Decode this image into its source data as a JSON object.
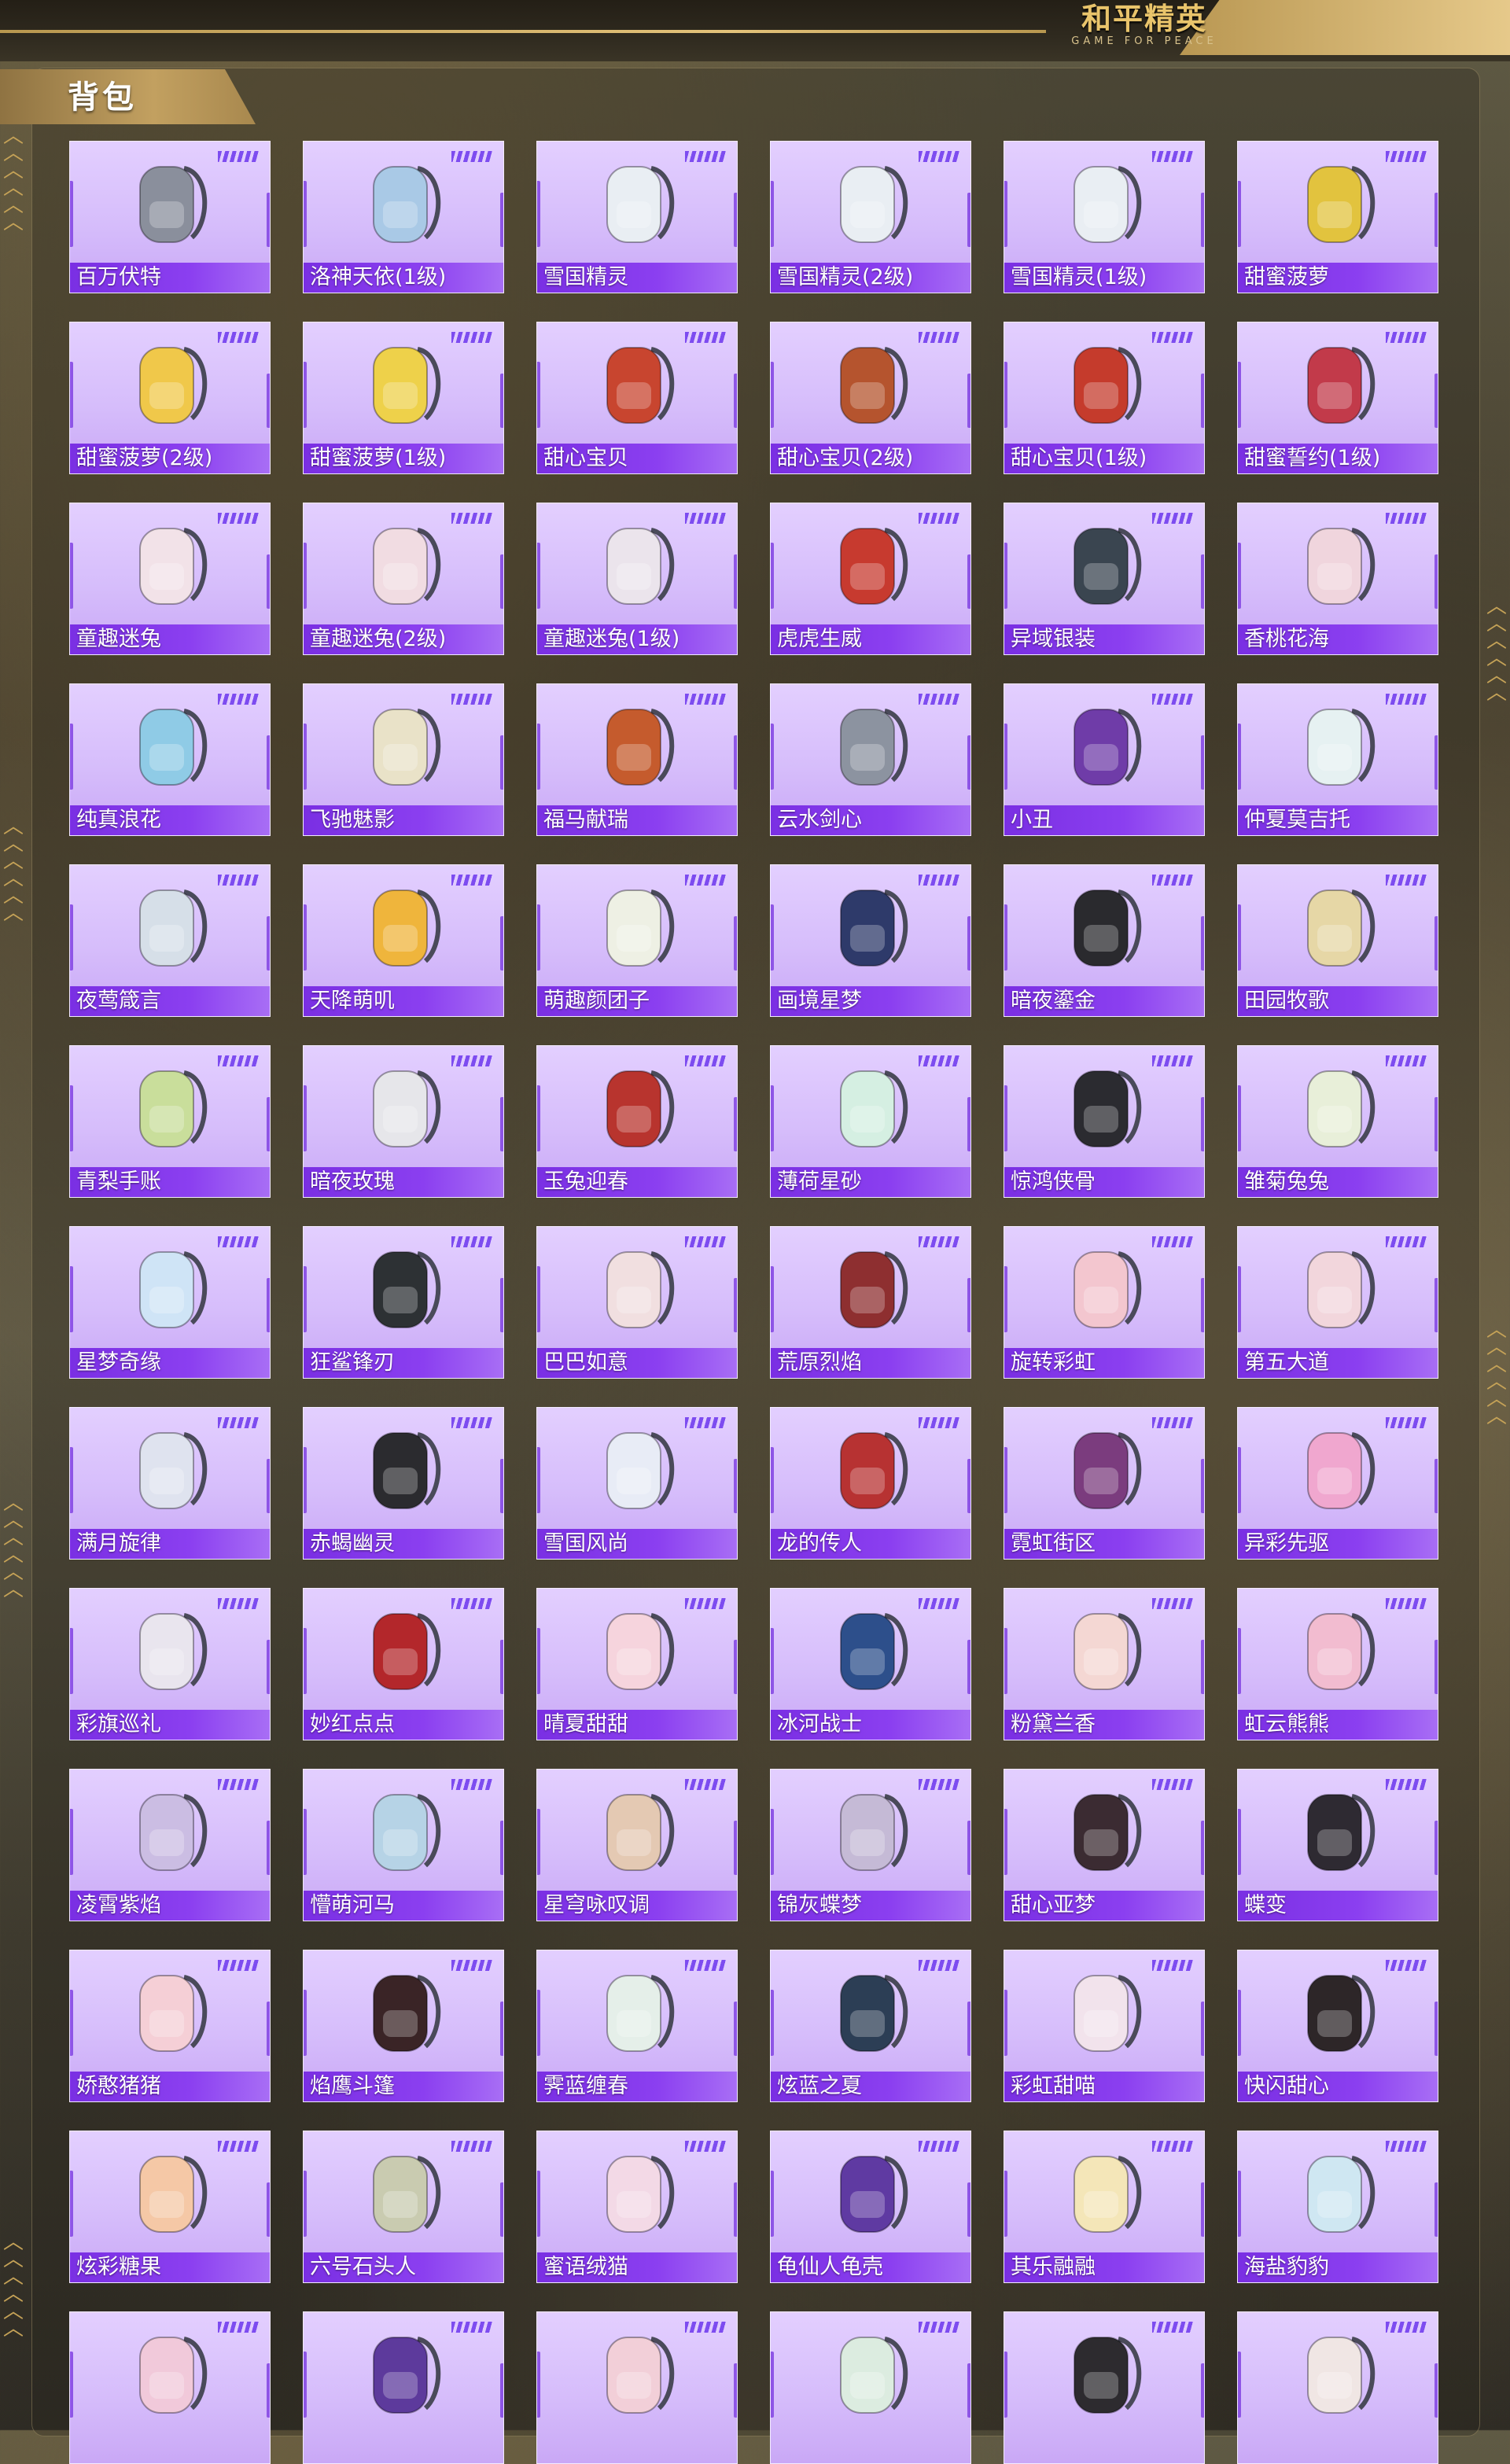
{
  "header": {
    "logo_cn": "和平精英",
    "logo_en": "GAME FOR PEACE"
  },
  "section": {
    "title": "背包"
  },
  "items": [
    {
      "name": "百万伏特",
      "color": "#8a8f9c"
    },
    {
      "name": "洛神天依(1级)",
      "color": "#a9c9e6"
    },
    {
      "name": "雪国精灵",
      "color": "#e9eef3"
    },
    {
      "name": "雪国精灵(2级)",
      "color": "#e9eef3"
    },
    {
      "name": "雪国精灵(1级)",
      "color": "#e9eef3"
    },
    {
      "name": "甜蜜菠萝",
      "color": "#e2c33e"
    },
    {
      "name": "甜蜜菠萝(2级)",
      "color": "#f0c84a"
    },
    {
      "name": "甜蜜菠萝(1级)",
      "color": "#eed14a"
    },
    {
      "name": "甜心宝贝",
      "color": "#c8452f"
    },
    {
      "name": "甜心宝贝(2级)",
      "color": "#b5542e"
    },
    {
      "name": "甜心宝贝(1级)",
      "color": "#c53b2c"
    },
    {
      "name": "甜蜜誓约(1级)",
      "color": "#c23a4a"
    },
    {
      "name": "童趣迷兔",
      "color": "#f2e2e8"
    },
    {
      "name": "童趣迷兔(2级)",
      "color": "#f1dce2"
    },
    {
      "name": "童趣迷兔(1级)",
      "color": "#ebe4ec"
    },
    {
      "name": "虎虎生威",
      "color": "#c73a2f"
    },
    {
      "name": "异域银装",
      "color": "#3a4550"
    },
    {
      "name": "香桃花海",
      "color": "#f0d5dd"
    },
    {
      "name": "纯真浪花",
      "color": "#8fcbe6"
    },
    {
      "name": "飞驰魅影",
      "color": "#e9e2c8"
    },
    {
      "name": "福马献瑞",
      "color": "#c55b2d"
    },
    {
      "name": "云水剑心",
      "color": "#8c93a0"
    },
    {
      "name": "小丑",
      "color": "#6f3ca8"
    },
    {
      "name": "仲夏莫吉托",
      "color": "#e6f1f2"
    },
    {
      "name": "夜莺箴言",
      "color": "#d6dfe8"
    },
    {
      "name": "天降萌叽",
      "color": "#efb53c"
    },
    {
      "name": "萌趣颜团子",
      "color": "#eef0e4"
    },
    {
      "name": "画境星梦",
      "color": "#2e3a6a"
    },
    {
      "name": "暗夜鎏金",
      "color": "#2a2a2e"
    },
    {
      "name": "田园牧歌",
      "color": "#e6d7a6"
    },
    {
      "name": "青梨手账",
      "color": "#c9de9b"
    },
    {
      "name": "暗夜玫瑰",
      "color": "#e6e6ea"
    },
    {
      "name": "玉兔迎春",
      "color": "#b8342e"
    },
    {
      "name": "薄荷星砂",
      "color": "#d5efe2"
    },
    {
      "name": "惊鸿侠骨",
      "color": "#2b2b30"
    },
    {
      "name": "雏菊兔兔",
      "color": "#e8efd9"
    },
    {
      "name": "星梦奇缘",
      "color": "#cfe4f6"
    },
    {
      "name": "狂鲨锋刃",
      "color": "#2d3134"
    },
    {
      "name": "巴巴如意",
      "color": "#f1dfe0"
    },
    {
      "name": "荒原烈焰",
      "color": "#8e2f30"
    },
    {
      "name": "旋转彩虹",
      "color": "#f3c6cf"
    },
    {
      "name": "第五大道",
      "color": "#f2d6dc"
    },
    {
      "name": "满月旋律",
      "color": "#dfe3ef"
    },
    {
      "name": "赤蝎幽灵",
      "color": "#2b2b2f"
    },
    {
      "name": "雪国风尚",
      "color": "#e8ecf6"
    },
    {
      "name": "龙的传人",
      "color": "#b73232"
    },
    {
      "name": "霓虹街区",
      "color": "#7b3c7e"
    },
    {
      "name": "异彩先驱",
      "color": "#f0a7cf"
    },
    {
      "name": "彩旗巡礼",
      "color": "#e9e5ee"
    },
    {
      "name": "妙红点点",
      "color": "#b3272b"
    },
    {
      "name": "晴夏甜甜",
      "color": "#f6d4dd"
    },
    {
      "name": "冰河战士",
      "color": "#2d4f8b"
    },
    {
      "name": "粉黛兰香",
      "color": "#f4d7d3"
    },
    {
      "name": "虹云熊熊",
      "color": "#f2bcd0"
    },
    {
      "name": "凌霄紫焰",
      "color": "#cbbde3"
    },
    {
      "name": "懵萌河马",
      "color": "#b6d3e6"
    },
    {
      "name": "星穹咏叹调",
      "color": "#e4c9b3"
    },
    {
      "name": "锦灰蝶梦",
      "color": "#c5bad6"
    },
    {
      "name": "甜心亚梦",
      "color": "#3b2b32"
    },
    {
      "name": "蝶变",
      "color": "#2e2a32"
    },
    {
      "name": "娇憨猪猪",
      "color": "#f5cfd6"
    },
    {
      "name": "焰鹰斗篷",
      "color": "#3a2426"
    },
    {
      "name": "霁蓝缠春",
      "color": "#e5efe9"
    },
    {
      "name": "炫蓝之夏",
      "color": "#2c3e55"
    },
    {
      "name": "彩虹甜喵",
      "color": "#f2e3ec"
    },
    {
      "name": "快闪甜心",
      "color": "#2d2628"
    },
    {
      "name": "炫彩糖果",
      "color": "#f5c8a6"
    },
    {
      "name": "六号石头人",
      "color": "#c9cbb0"
    },
    {
      "name": "蜜语绒猫",
      "color": "#f3d9e6"
    },
    {
      "name": "龟仙人龟壳",
      "color": "#5f3aa2"
    },
    {
      "name": "其乐融融",
      "color": "#f4e6b8"
    },
    {
      "name": "海盐豹豹",
      "color": "#cfe7f2"
    },
    {
      "name": "",
      "color": "#f1c9da"
    },
    {
      "name": "",
      "color": "#5d3a9c"
    },
    {
      "name": "",
      "color": "#f2cfd8"
    },
    {
      "name": "",
      "color": "#dcece0"
    },
    {
      "name": "",
      "color": "#2d2b2f"
    },
    {
      "name": "",
      "color": "#f0e6e4"
    }
  ]
}
